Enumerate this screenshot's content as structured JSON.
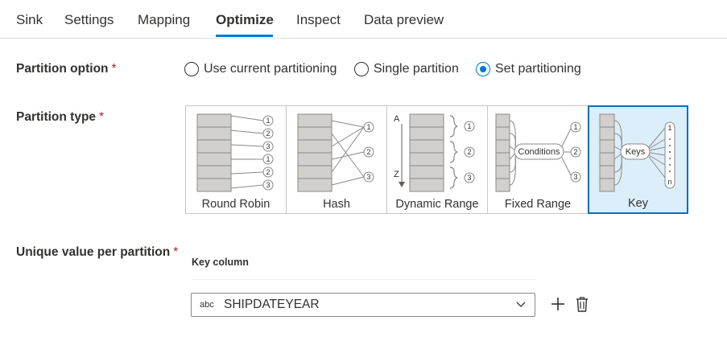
{
  "tabs": [
    {
      "label": "Sink"
    },
    {
      "label": "Settings"
    },
    {
      "label": "Mapping"
    },
    {
      "label": "Optimize"
    },
    {
      "label": "Inspect"
    },
    {
      "label": "Data preview"
    }
  ],
  "active_tab": "Optimize",
  "partition_option": {
    "label": "Partition option",
    "required_mark": "*",
    "options": [
      "Use current partitioning",
      "Single partition",
      "Set partitioning"
    ],
    "selected": "Set partitioning"
  },
  "partition_type": {
    "label": "Partition type",
    "required_mark": "*",
    "tiles": [
      {
        "label": "Round Robin"
      },
      {
        "label": "Hash"
      },
      {
        "label": "Dynamic Range",
        "range_start": "A",
        "range_end": "Z"
      },
      {
        "label": "Fixed Range",
        "node_text": "Conditions"
      },
      {
        "label": "Key",
        "node_text": "Keys",
        "last_output": "n"
      }
    ],
    "outputs": [
      "1",
      "2",
      "3"
    ],
    "selected": "Key"
  },
  "unique_value": {
    "label": "Unique value per partition",
    "required_mark": "*",
    "key_column_label": "Key column",
    "type_badge": "abc",
    "value": "SHIPDATEYEAR"
  },
  "icons": [
    "chevron-down-icon",
    "plus-icon",
    "trash-icon"
  ],
  "colors": {
    "accent": "#0078d4",
    "required": "#a4262c",
    "selected_tile_bg": "#ddeefb",
    "bar_fill": "#d2d0ce"
  }
}
